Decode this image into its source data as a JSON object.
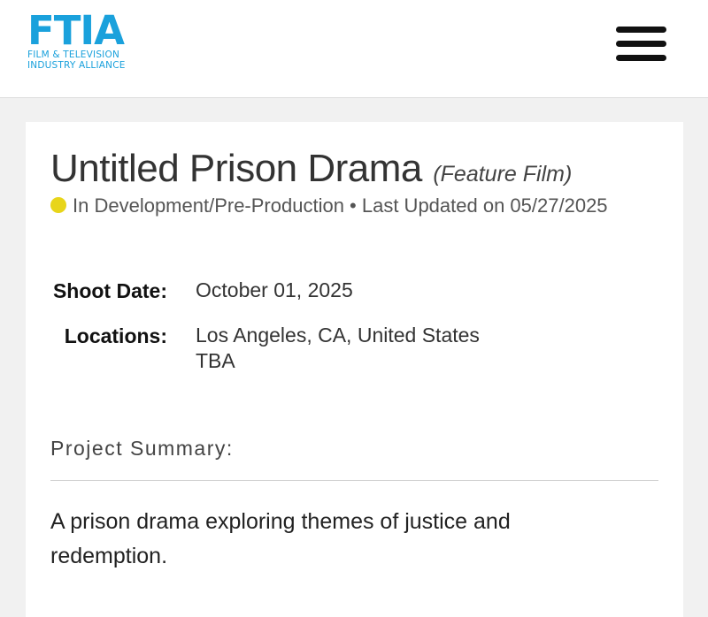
{
  "header": {
    "logo_mark": "FTIA",
    "logo_line1": "Film & Television",
    "logo_line2": "Industry Alliance",
    "brand_color": "#1aa1dc",
    "menu_icon": "hamburger-menu-icon"
  },
  "project": {
    "title": "Untitled Prison Drama",
    "type": "(Feature Film)",
    "status_color": "#e8d51a",
    "status_text": "In Development/Pre-Production • Last Updated on 05/27/2025"
  },
  "details": {
    "shoot_date_label": "Shoot Date:",
    "shoot_date_value": "October 01, 2025",
    "locations_label": "Locations:",
    "locations": [
      "Los Angeles, CA, United States",
      "TBA"
    ]
  },
  "summary": {
    "heading": "Project Summary:",
    "text": "A prison drama exploring themes of justice and redemption."
  }
}
